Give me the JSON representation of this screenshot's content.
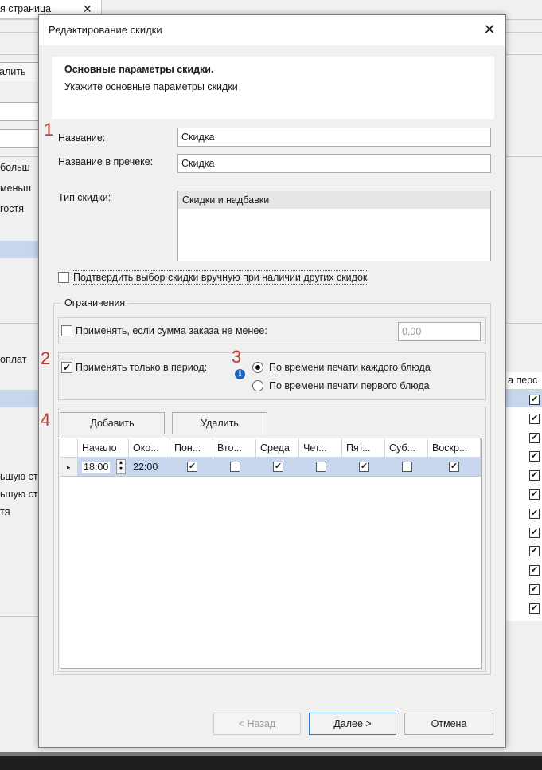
{
  "background": {
    "tab_label": "я страница",
    "tab_close": "✕",
    "button_label": "алить",
    "left_texts": [
      "больш",
      "меньш",
      "гостя"
    ],
    "left_texts_2": [
      "оплат"
    ],
    "left_texts_3": [
      "ьшую ст",
      "ьшую ст",
      "тя"
    ],
    "right_header": "а перс",
    "right_checks": [
      true,
      true,
      true,
      true,
      true,
      true,
      true,
      true,
      true,
      true,
      true,
      true
    ]
  },
  "dialog": {
    "title": "Редактирование скидки",
    "close_icon": "✕",
    "header": {
      "title": "Основные параметры скидки.",
      "subtitle": "Укажите основные параметры скидки"
    },
    "markers": [
      "1",
      "2",
      "3",
      "4"
    ],
    "fields": {
      "name_label": "Название:",
      "name_value": "Скидка",
      "receipt_name_label": "Название в пречеке:",
      "receipt_name_value": "Скидка",
      "type_label": "Тип скидки:",
      "type_items": [
        "Скидки и надбавки"
      ]
    },
    "confirm_manual": {
      "label": "Подтвердить выбор скидки вручную при наличии других скидок",
      "checked": false
    },
    "restrictions": {
      "title": "Ограничения",
      "min_sum_label": "Применять, если сумма заказа не менее:",
      "min_sum_checked": false,
      "min_sum_value": "0,00",
      "period_label": "Применять только в период:",
      "period_checked": true,
      "info_icon": "i",
      "radio_each": "По времени печати каждого блюда",
      "radio_first": "По времени печати первого блюда",
      "radio_selected": "each"
    },
    "grid": {
      "add_button": "Добавить",
      "delete_button": "Удалить",
      "columns": [
        "Начало",
        "Око...",
        "Пон...",
        "Вто...",
        "Среда",
        "Чет...",
        "Пят...",
        "Суб...",
        "Воскр..."
      ],
      "rows": [
        {
          "start": "18:00",
          "end": "22:00",
          "days": [
            true,
            false,
            true,
            false,
            true,
            false,
            true
          ]
        }
      ],
      "row_marker": "▸",
      "spin_up": "▲",
      "spin_down": "▼"
    },
    "footer": {
      "back": "< Назад",
      "next": "Далее >",
      "cancel": "Отмена"
    }
  }
}
